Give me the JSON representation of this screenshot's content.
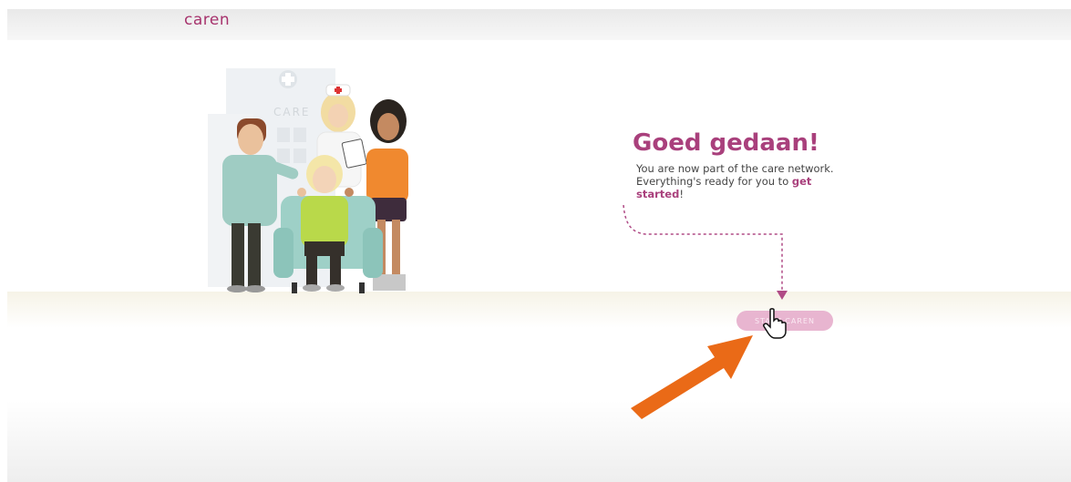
{
  "app": {
    "logo": "caren"
  },
  "illustration": {
    "sign": "CARE"
  },
  "confirmation": {
    "title": "Goed gedaan!",
    "message_part1": "You are now part of the care network. Everything's ready for you to ",
    "message_link": "get started",
    "message_end": "!"
  },
  "button": {
    "label": "START CAREN"
  },
  "colors": {
    "brand": "#a9407c",
    "button": "#e8b5d0",
    "annotation_arrow": "#ea6a17"
  },
  "icons": {
    "cursor": "hand-pointer-icon",
    "annotation": "arrow-icon"
  }
}
